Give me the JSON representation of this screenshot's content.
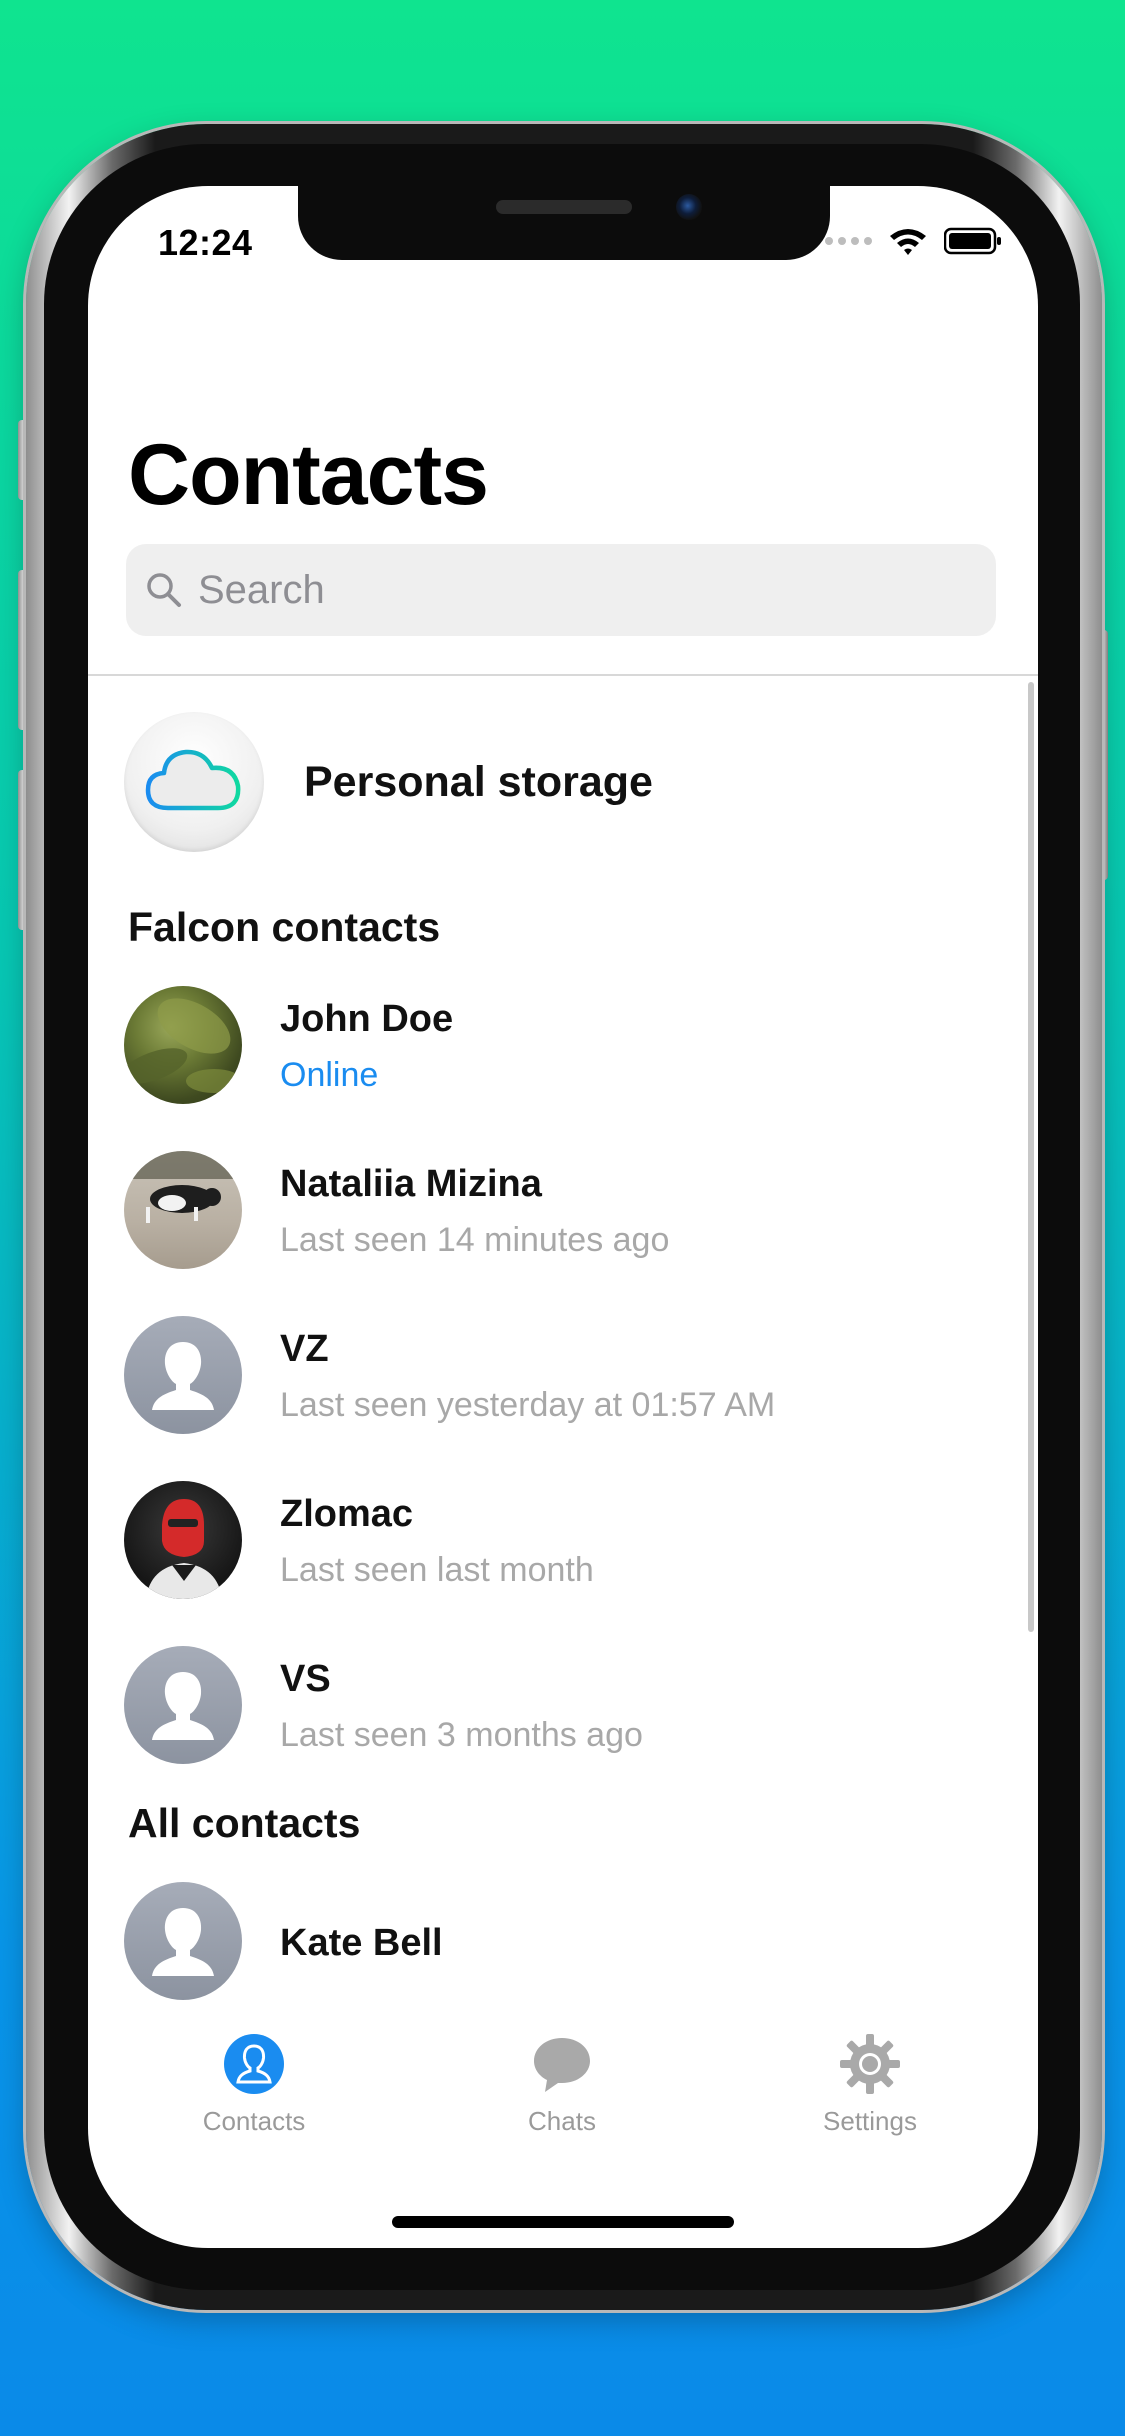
{
  "colors": {
    "accent": "#1a8cf0",
    "secondary_text": "#a8a8a8",
    "tab_inactive": "#9a9a9a"
  },
  "status_bar": {
    "time": "12:24",
    "icons": [
      "signal-dots-icon",
      "wifi-icon",
      "battery-icon"
    ]
  },
  "header": {
    "title": "Contacts"
  },
  "search": {
    "placeholder": "Search",
    "icon": "magnifier-icon"
  },
  "personal_storage": {
    "label": "Personal storage",
    "icon": "cloud-icon"
  },
  "sections": {
    "falcon_title": "Falcon contacts",
    "all_title": "All contacts"
  },
  "falcon_contacts": [
    {
      "name": "John Doe",
      "status": "Online",
      "online": true,
      "avatar": "photo-leaves"
    },
    {
      "name": "Nataliia Mizina",
      "status": "Last seen 14 minutes ago",
      "online": false,
      "avatar": "photo-cat"
    },
    {
      "name": "VZ",
      "status": "Last seen yesterday at 01:57 AM",
      "online": false,
      "avatar": "default-person"
    },
    {
      "name": "Zlomac",
      "status": "Last seen last month",
      "online": false,
      "avatar": "photo-masked-person"
    },
    {
      "name": "VS",
      "status": "Last seen 3 months ago",
      "online": false,
      "avatar": "default-person"
    }
  ],
  "all_contacts": [
    {
      "name": "Kate Bell",
      "avatar": "default-person"
    }
  ],
  "tab_bar": {
    "tabs": [
      {
        "label": "Contacts",
        "icon": "person-icon",
        "selected": true
      },
      {
        "label": "Chats",
        "icon": "chat-bubble-icon",
        "selected": false
      },
      {
        "label": "Settings",
        "icon": "gear-icon",
        "selected": false
      }
    ]
  }
}
